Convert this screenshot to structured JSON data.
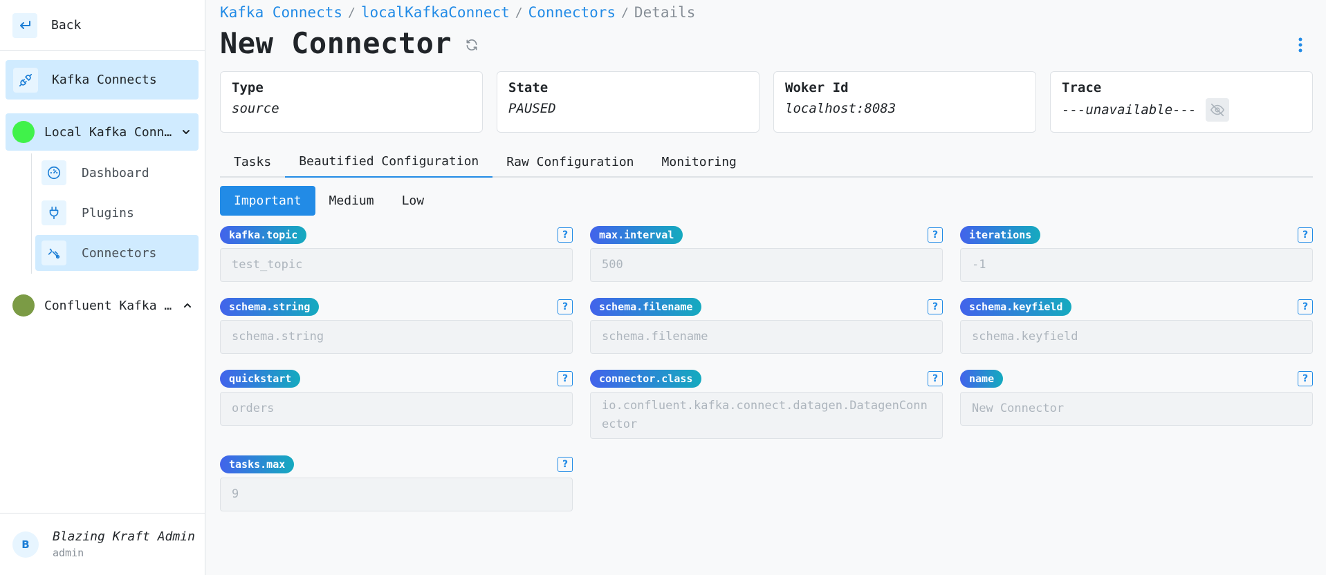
{
  "sidebar": {
    "back_label": "Back",
    "kafka_connects_label": "Kafka Connects",
    "clusters": [
      {
        "label": "Local Kafka Connect",
        "color": "#40f24a",
        "expanded": true
      },
      {
        "label": "Confluent Kafka Connect",
        "color": "#7b9b45",
        "expanded": true
      }
    ],
    "sub_items": [
      {
        "label": "Dashboard"
      },
      {
        "label": "Plugins"
      },
      {
        "label": "Connectors"
      }
    ],
    "user": {
      "initial": "B",
      "name": "Blazing Kraft Admin",
      "role": "admin"
    }
  },
  "breadcrumb": [
    {
      "label": "Kafka Connects"
    },
    {
      "label": "localKafkaConnect"
    },
    {
      "label": "Connectors"
    },
    {
      "label": "Details"
    }
  ],
  "page_title": "New Connector",
  "cards": [
    {
      "label": "Type",
      "value": "source"
    },
    {
      "label": "State",
      "value": "PAUSED"
    },
    {
      "label": "Woker Id",
      "value": "localhost:8083"
    },
    {
      "label": "Trace",
      "value": "---unavailable---"
    }
  ],
  "tabs": [
    {
      "label": "Tasks"
    },
    {
      "label": "Beautified Configuration"
    },
    {
      "label": "Raw Configuration"
    },
    {
      "label": "Monitoring"
    }
  ],
  "priority_tabs": [
    {
      "label": "Important"
    },
    {
      "label": "Medium"
    },
    {
      "label": "Low"
    }
  ],
  "help_glyph": "?",
  "fields": [
    {
      "name": "kafka.topic",
      "value": "test_topic"
    },
    {
      "name": "max.interval",
      "value": "500"
    },
    {
      "name": "iterations",
      "value": "-1"
    },
    {
      "name": "schema.string",
      "value": "schema.string"
    },
    {
      "name": "schema.filename",
      "value": "schema.filename"
    },
    {
      "name": "schema.keyfield",
      "value": "schema.keyfield"
    },
    {
      "name": "quickstart",
      "value": "orders"
    },
    {
      "name": "connector.class",
      "value": "io.confluent.kafka.connect.datagen.DatagenConnector"
    },
    {
      "name": "name",
      "value": "New Connector"
    },
    {
      "name": "tasks.max",
      "value": "9"
    }
  ]
}
